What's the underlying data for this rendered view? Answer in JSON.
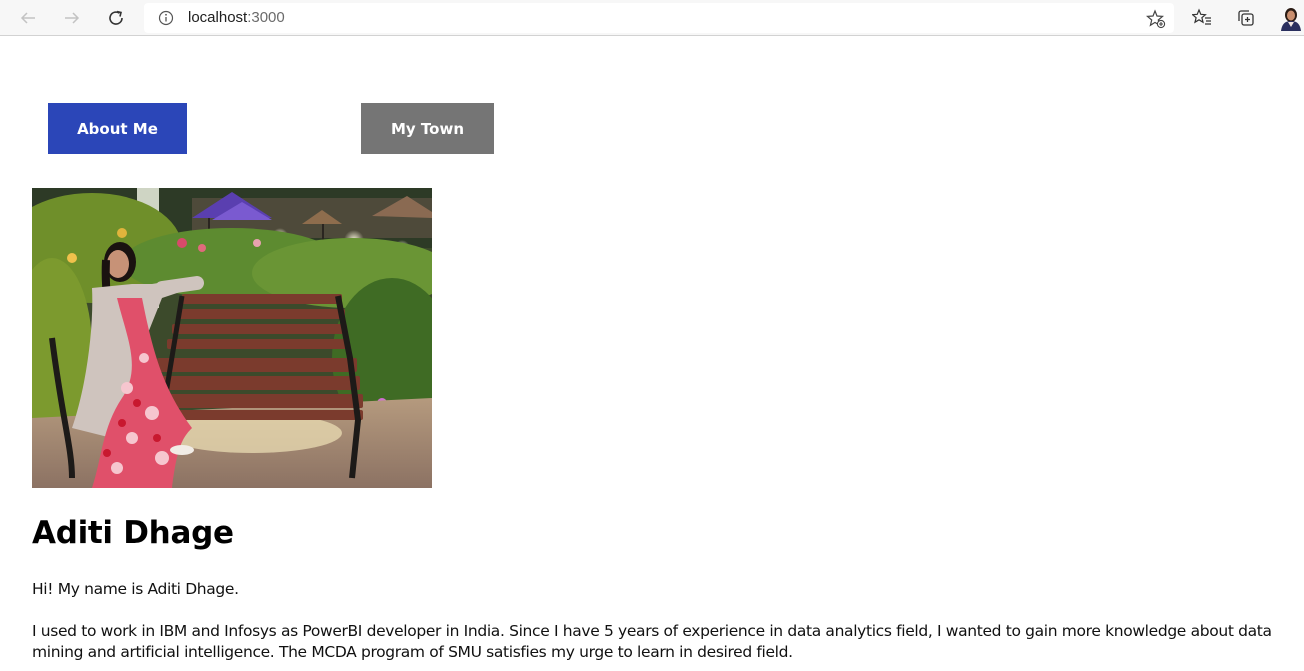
{
  "browser": {
    "url_host": "localhost",
    "url_port": ":3000",
    "icons": {
      "back": "back-arrow-icon",
      "forward": "forward-arrow-icon",
      "reload": "reload-icon",
      "info": "info-icon",
      "add_favorite": "add-favorite-icon",
      "favorites": "favorites-icon",
      "collections": "collections-icon",
      "profile": "profile-avatar"
    }
  },
  "nav": {
    "about_label": "About Me",
    "town_label": "My Town",
    "about_color": "#2b46b8",
    "town_color": "#757575"
  },
  "profile": {
    "name": "Aditi Dhage",
    "intro": "Hi! My name is Aditi Dhage.",
    "bio": "I used to work in IBM and Infosys as PowerBI developer in India. Since I have 5 years of experience in data analytics field, I wanted to gain more knowledge about data mining and artificial intelligence. The MCDA program of SMU satisfies my urge to learn in desired field."
  }
}
